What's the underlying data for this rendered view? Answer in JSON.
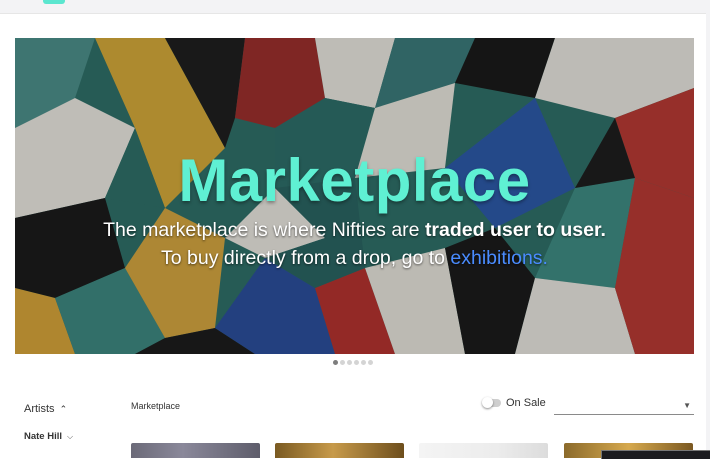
{
  "hero": {
    "title": "Marketplace",
    "line1_text": "The marketplace is where Nifties are ",
    "line1_bold": "traded user to user.",
    "line2_text": "To buy directly from a drop, go to ",
    "line2_link": "exhibitions.",
    "title_color": "#5ff0d3",
    "link_color": "#4a8cff"
  },
  "carousel": {
    "slide_count": 6,
    "active_index": 0
  },
  "filters": {
    "section_label": "Artists",
    "artist_name": "Nate Hill"
  },
  "main": {
    "breadcrumb": "Marketplace",
    "on_sale_label": "On Sale",
    "on_sale_enabled": false,
    "sort_value": ""
  },
  "icons": {
    "collapse": "chevron-up-icon",
    "expand": "chevron-down-icon",
    "dropdown": "dropdown-arrow-icon"
  }
}
